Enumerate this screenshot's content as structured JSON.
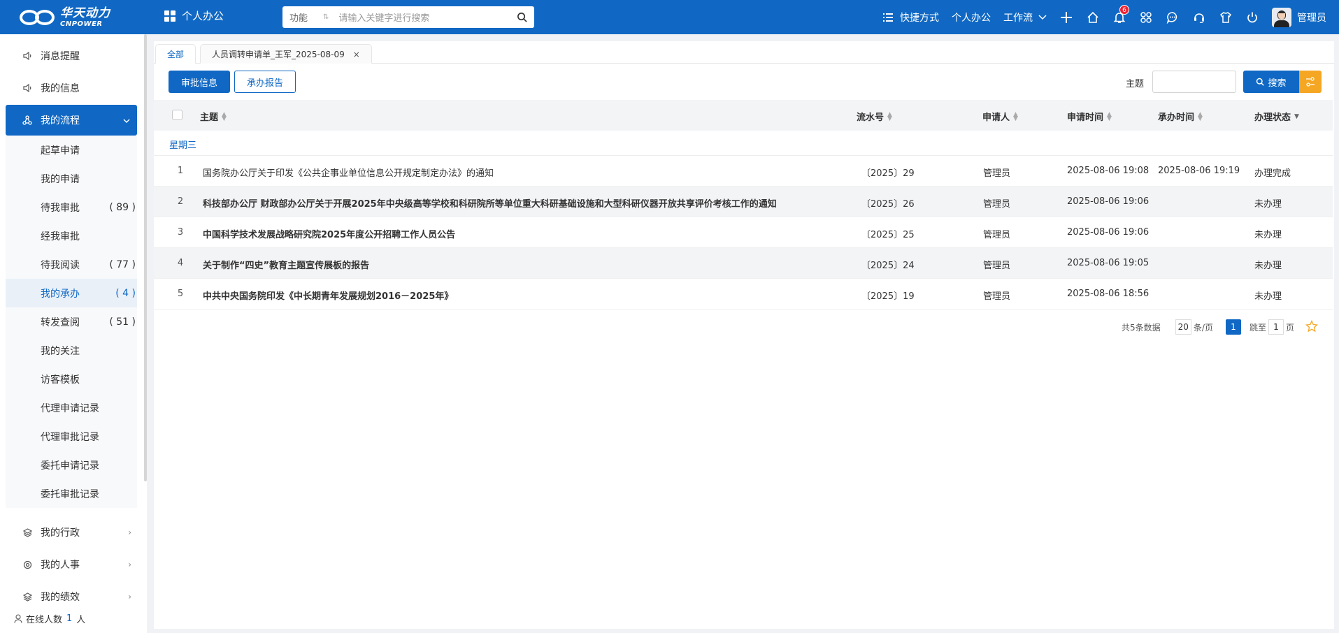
{
  "brand": {
    "name_cn": "华天动力",
    "name_en": "CNPOWER"
  },
  "header": {
    "module": "个人办公",
    "search": {
      "func_label": "功能",
      "placeholder": "请输入关键字进行搜索"
    },
    "nav": {
      "shortcuts": "快捷方式",
      "personal_office": "个人办公",
      "workflow": "工作流"
    },
    "notification_count": "6",
    "user_name": "管理员"
  },
  "sidebar": {
    "top_items": [
      {
        "label": "消息提醒",
        "icon": "speaker-icon"
      },
      {
        "label": "我的信息",
        "icon": "speaker-icon"
      }
    ],
    "active_group": {
      "label": "我的流程",
      "icon": "flow-icon"
    },
    "sub_items": [
      {
        "label": "起草申请",
        "count": ""
      },
      {
        "label": "我的申请",
        "count": ""
      },
      {
        "label": "待我审批",
        "count": "( 89 )"
      },
      {
        "label": "经我审批",
        "count": ""
      },
      {
        "label": "待我阅读",
        "count": "( 77 )"
      },
      {
        "label": "我的承办",
        "count": "( 4 )"
      },
      {
        "label": "转发查阅",
        "count": "( 51 )"
      },
      {
        "label": "我的关注",
        "count": ""
      },
      {
        "label": "访客模板",
        "count": ""
      },
      {
        "label": "代理申请记录",
        "count": ""
      },
      {
        "label": "代理审批记录",
        "count": ""
      },
      {
        "label": "委托申请记录",
        "count": ""
      },
      {
        "label": "委托审批记录",
        "count": ""
      }
    ],
    "bottom_groups": [
      {
        "label": "我的行政",
        "icon": "layers-icon"
      },
      {
        "label": "我的人事",
        "icon": "gear-icon"
      },
      {
        "label": "我的绩效",
        "icon": "layers-icon"
      }
    ],
    "online": {
      "prefix": "在线人数",
      "count": "1",
      "suffix": "人"
    }
  },
  "tabs": [
    {
      "label": "全部"
    },
    {
      "label": "人员调转申请单_王军_2025-08-09",
      "close": "×"
    }
  ],
  "toolbar": {
    "approval_info": "审批信息",
    "handling_report": "承办报告",
    "subject_label": "主题",
    "search_label": "搜索"
  },
  "table": {
    "columns": {
      "subject": "主题",
      "serial": "流水号",
      "applicant": "申请人",
      "apply_time": "申请时间",
      "handle_time": "承办时间",
      "status": "办理状态"
    },
    "group": "星期三",
    "rows": [
      {
        "idx": "1",
        "subject": "国务院办公厅关于印发《公共企事业单位信息公开规定制定办法》的通知",
        "serial": "〔2025〕29",
        "applicant": "管理员",
        "apply_time": "2025-08-06 19:08",
        "handle_time": "2025-08-06 19:19",
        "status": "办理完成"
      },
      {
        "idx": "2",
        "subject": "科技部办公厅 财政部办公厅关于开展2025年中央级高等学校和科研院所等单位重大科研基础设施和大型科研仪器开放共享评价考核工作的通知",
        "serial": "〔2025〕26",
        "applicant": "管理员",
        "apply_time": "2025-08-06 19:06",
        "handle_time": "",
        "status": "未办理"
      },
      {
        "idx": "3",
        "subject": "中国科学技术发展战略研究院2025年度公开招聘工作人员公告",
        "serial": "〔2025〕25",
        "applicant": "管理员",
        "apply_time": "2025-08-06 19:06",
        "handle_time": "",
        "status": "未办理"
      },
      {
        "idx": "4",
        "subject": "关于制作“四史”教育主题宣传展板的报告",
        "serial": "〔2025〕24",
        "applicant": "管理员",
        "apply_time": "2025-08-06 19:05",
        "handle_time": "",
        "status": "未办理"
      },
      {
        "idx": "5",
        "subject": "中共中央国务院印发《中长期青年发展规划2016－2025年》",
        "serial": "〔2025〕19",
        "applicant": "管理员",
        "apply_time": "2025-08-06 18:56",
        "handle_time": "",
        "status": "未办理"
      }
    ]
  },
  "pagination": {
    "total": "共5条数据",
    "page_size": "20",
    "per_page": "条/页",
    "current": "1",
    "jump_label": "跳至",
    "jump_value": "1",
    "page_unit": "页"
  },
  "colors": {
    "primary": "#1068c4",
    "accent": "#f5a623",
    "badge": "#e23"
  }
}
